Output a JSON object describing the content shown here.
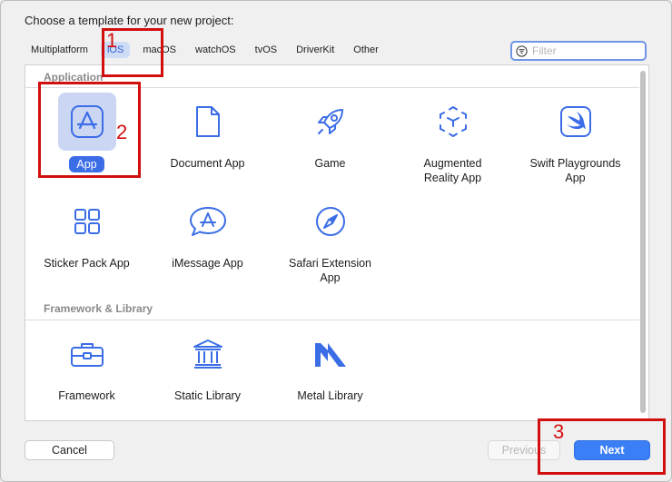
{
  "title": "Choose a template for your new project:",
  "tabs": [
    "Multiplatform",
    "iOS",
    "macOS",
    "watchOS",
    "tvOS",
    "DriverKit",
    "Other"
  ],
  "selected_tab": "iOS",
  "filter": {
    "placeholder": "Filter",
    "value": ""
  },
  "sections": {
    "application": "Application",
    "framework": "Framework & Library"
  },
  "application_items": [
    {
      "label": "App",
      "icon": "app-store-icon",
      "selected": true
    },
    {
      "label": "Document App",
      "icon": "document-icon"
    },
    {
      "label": "Game",
      "icon": "rocket-icon"
    },
    {
      "label": "Augmented\nReality App",
      "icon": "ar-cube-icon"
    },
    {
      "label": "Swift Playgrounds\nApp",
      "icon": "swift-icon"
    },
    {
      "label": "Sticker Pack App",
      "icon": "grid-icon"
    },
    {
      "label": "iMessage App",
      "icon": "imessage-app-icon"
    },
    {
      "label": "Safari Extension\nApp",
      "icon": "compass-icon"
    }
  ],
  "framework_items": [
    {
      "label": "Framework",
      "icon": "toolbox-icon"
    },
    {
      "label": "Static Library",
      "icon": "columns-icon"
    },
    {
      "label": "Metal Library",
      "icon": "metal-icon"
    }
  ],
  "buttons": {
    "cancel": "Cancel",
    "previous": "Previous",
    "next": "Next"
  },
  "annotations": [
    "1",
    "2",
    "3"
  ],
  "colors": {
    "accent": "#3b6de6",
    "annotation": "#d20f0f",
    "selected_bg": "#cbd6f3"
  }
}
